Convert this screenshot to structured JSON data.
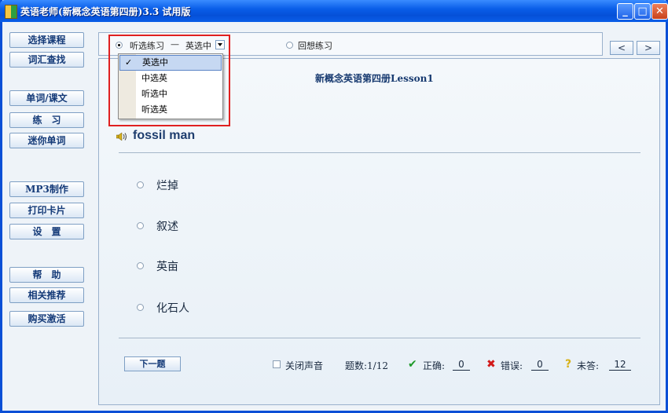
{
  "window": {
    "title": "英语老师(新概念英语第四册)3.3 试用版",
    "min_glyph": "_",
    "max_glyph": "□",
    "close_glyph": "✕"
  },
  "sidebar": {
    "items": [
      {
        "label": "选择课程",
        "name": "select-course"
      },
      {
        "label": "词汇查找",
        "name": "vocab-search"
      },
      {
        "label": "单词/课文",
        "name": "words-text"
      },
      {
        "label": "练　习",
        "name": "practice"
      },
      {
        "label": "迷你单词",
        "name": "mini-words"
      },
      {
        "label": "MP3制作",
        "name": "mp3-make"
      },
      {
        "label": "打印卡片",
        "name": "print-cards"
      },
      {
        "label": "设　置",
        "name": "settings"
      },
      {
        "label": "帮　助",
        "name": "help"
      },
      {
        "label": "相关推荐",
        "name": "recommend"
      },
      {
        "label": "购买激活",
        "name": "buy-activate"
      }
    ]
  },
  "mode": {
    "listen_label": "听选练习",
    "separator": "—",
    "selected_sub": "英选中",
    "recall_label": "回想练习"
  },
  "nav": {
    "prev_glyph": "<",
    "next_glyph": ">"
  },
  "dropdown": {
    "options": [
      "英选中",
      "中选英",
      "听选中",
      "听选英"
    ],
    "selected_index": 0,
    "check_glyph": "✓"
  },
  "lesson": {
    "title": "新概念英语第四册Lesson1",
    "word": "fossil man",
    "options": [
      "烂掉",
      "叙述",
      "英亩",
      "化石人"
    ]
  },
  "footer": {
    "next_label": "下一题",
    "mute_label": "关闭声音",
    "count_label": "题数:1/12",
    "correct_label": "正确:",
    "correct_value": "0",
    "wrong_label": "错误:",
    "wrong_value": "0",
    "unanswered_label": "未答:",
    "unanswered_value": "12"
  },
  "colors": {
    "titlebar": "#0a5ee8",
    "highlight_box": "#e02020",
    "correct_icon": "#1f9a2a",
    "wrong_icon": "#d21a1a",
    "unanswered_icon": "#d8b21a"
  }
}
